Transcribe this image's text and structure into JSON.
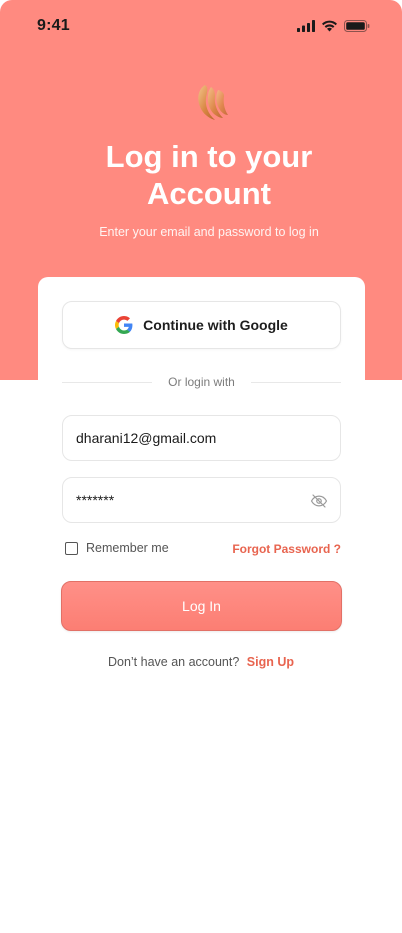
{
  "status_bar": {
    "time": "9:41"
  },
  "header": {
    "title_line1": "Log in to your",
    "title_line2": "Account",
    "subtitle": "Enter your email and password to log in"
  },
  "google": {
    "label": "Continue with Google"
  },
  "divider": {
    "text": "Or login with"
  },
  "form": {
    "email_value": "dharani12@gmail.com",
    "password_value": "*******",
    "remember_label": "Remember me",
    "forgot_label": "Forgot Password ?",
    "login_label": "Log In"
  },
  "footer": {
    "prompt": "Don’t have an account?",
    "signup_label": "Sign Up"
  },
  "colors": {
    "hero": "#FF8A80",
    "accent": "#E8644F",
    "button": "#FC7E73"
  },
  "icons": [
    "signal-icon",
    "wifi-icon",
    "battery-icon",
    "logo-icon",
    "google-icon",
    "eye-off-icon"
  ]
}
